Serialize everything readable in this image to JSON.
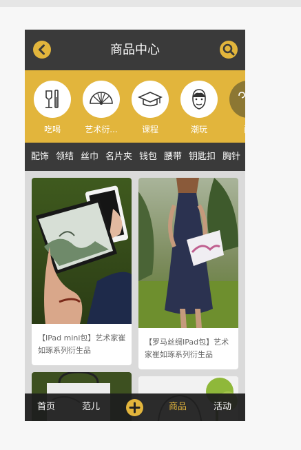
{
  "header": {
    "title": "商品中心",
    "back_icon": "chevron-left-icon",
    "search_icon": "search-icon"
  },
  "categories": [
    {
      "label": "吃喝",
      "icon": "wine-glass-icon"
    },
    {
      "label": "艺术衍...",
      "icon": "folding-fan-icon"
    },
    {
      "label": "课程",
      "icon": "graduation-cap-icon"
    },
    {
      "label": "潮玩",
      "icon": "face-icon"
    },
    {
      "label": "配",
      "icon": "hanger-icon"
    }
  ],
  "subnav": [
    "配饰",
    "领结",
    "丝巾",
    "名片夹",
    "钱包",
    "腰带",
    "钥匙扣",
    "胸针"
  ],
  "products": [
    {
      "caption": "【IPad mini包】艺术家崔如琢系列衍生品"
    },
    {
      "caption": "【罗马丝绸IPad包】艺术家崔如琢系列衍生品"
    }
  ],
  "tabbar": {
    "items": [
      "首页",
      "范儿",
      "商品",
      "活动"
    ],
    "active": "商品",
    "add_icon": "plus-icon"
  },
  "colors": {
    "accent": "#e2b53c",
    "dark": "#3a3a3a",
    "background": "#dadada"
  }
}
